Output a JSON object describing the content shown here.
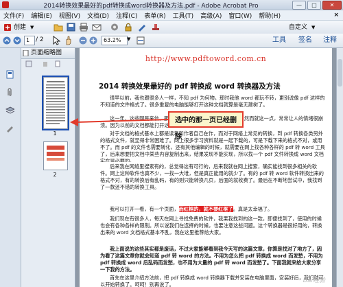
{
  "window": {
    "title": "2014转换效果最好的pdf转换成word转换器及方法.pdf - Adobe Acrobat Pro",
    "min": "—",
    "max": "□",
    "close": "✕"
  },
  "menu": [
    "文件(F)",
    "编辑(E)",
    "视图(V)",
    "文档(D)",
    "注释(C)",
    "表单(R)",
    "工具(T)",
    "高级(A)",
    "窗口(W)",
    "帮助(H)"
  ],
  "menu_close": "×",
  "toolbar": {
    "create_label": "创建",
    "custom_label": "自定义"
  },
  "toolbar2": {
    "page_current": "1",
    "page_total": "/ 2",
    "zoom": "63.2%",
    "tools": "工具",
    "sign": "签名",
    "comment": "注释"
  },
  "panel": {
    "title": "页面缩略图",
    "page1": "1",
    "page2": "2"
  },
  "document": {
    "url": "http://www.pdftoword.com.cn",
    "title": "2014 转换效果最好的 pdf 转换成 word 转换器及方法",
    "p1": "很早以前，我也跟很多人一样，不知 pdf 为何物。那时我他 word 都玩不转，更别说像 pdf 这样的不知道的文件格式了。很多重复的电脑能够打开这种文档就算是毫无建树了。",
    "p2": "这一年，这些网民来信，那网里不时能看到专门打开 pdf 了，然而就这一点，常常让人的情绪很崩溃。因为以前的文档都能打开这种文件，呵呵！",
    "p3": "对于文档的格式基本上都是读者和作者自己在作，而对于网络上常见的转换，到 pdf 转换各类另外的格式文件，就显得非常困难了。网上很多学习资料就是一起下载的，可是下载下来的格式不对，或用不了。而 pdf 的文件也需要转化，还有其他编辑的时候，就需要在网上找各种各样的 pdf 转 word 工具了，后来想要把文档中某些内容复制出来，结果发现不能实现，所以找一个 pdf 文件转换成 word 文档实在是必要的。",
    "p4": "后来我在网络里搜索有的，总觉得这有可行的，后来我就在网上搜索，确实能找到很多相关的软件。网上这种软件也真不少，一找一大堆，但是真正能用的就少了。有的 pdf 转 word 软件转换出来的格式不对，有的转换后有乱码，有的则只能转换几页，后面的就收费了。最后在不断地尝试中，我找到了一款还不错的转换工具。",
    "p5_before": "我可以打开一看，有一个页面，",
    "p5_hl": "而红框的，就不要红框了",
    "p5_after": "。真是太幸福了。",
    "p6": "我们现在有很多人，每天在网上寻找免费的软件，我果我找到的这一款，即便找到了，使用的时候也会有各种各样的限制。所以说我们在选择的时候，也要注意这些问题。这个转换器是很好用的，转换出来的 word 文档格式基本不乱，我在这里推荐给大家。",
    "p7": "我上面说的这些其实都是废话，不过大家能够看到我今天写的这篇文章，你算是找对了地方了，因为看了这篇文章你就会知道 pdf 转 word 的方法。不用为怎么把 pdf 转换成 word 而发愁，不用为 pdf 转换成 word 后乱码而发愁，也不用为大量的 pdf 转 word 而发愁了。下面我就来给大家分享一下我的方法。",
    "p8": "首先在这里介绍方法前，把 pdf 转换成 word 转换器下载并安装在电脑里面，安装好后，我们就可以开始转换了。呵呵！别再说了。",
    "watermark": "Bai经验"
  },
  "annotation": {
    "text": "选中的那一页已经删除"
  },
  "colors": {
    "accent": "#1d4f95",
    "url_red": "#d8332a",
    "annotation_border": "#e23a2a",
    "annotation_bg": "#fbf6cc"
  },
  "icons": [
    "acrobat-logo-icon",
    "create-icon",
    "open-folder-icon",
    "save-icon",
    "print-icon",
    "email-icon",
    "gear-icon",
    "secure-icon",
    "sign-pen-icon",
    "stamp-icon",
    "page-up-icon",
    "page-down-icon",
    "hand-tool-icon",
    "select-tool-icon",
    "zoom-out-icon",
    "zoom-in-icon",
    "fit-width-icon",
    "pages-icon",
    "bookmark-icon",
    "paperclip-icon",
    "layers-icon",
    "signature-icon"
  ]
}
